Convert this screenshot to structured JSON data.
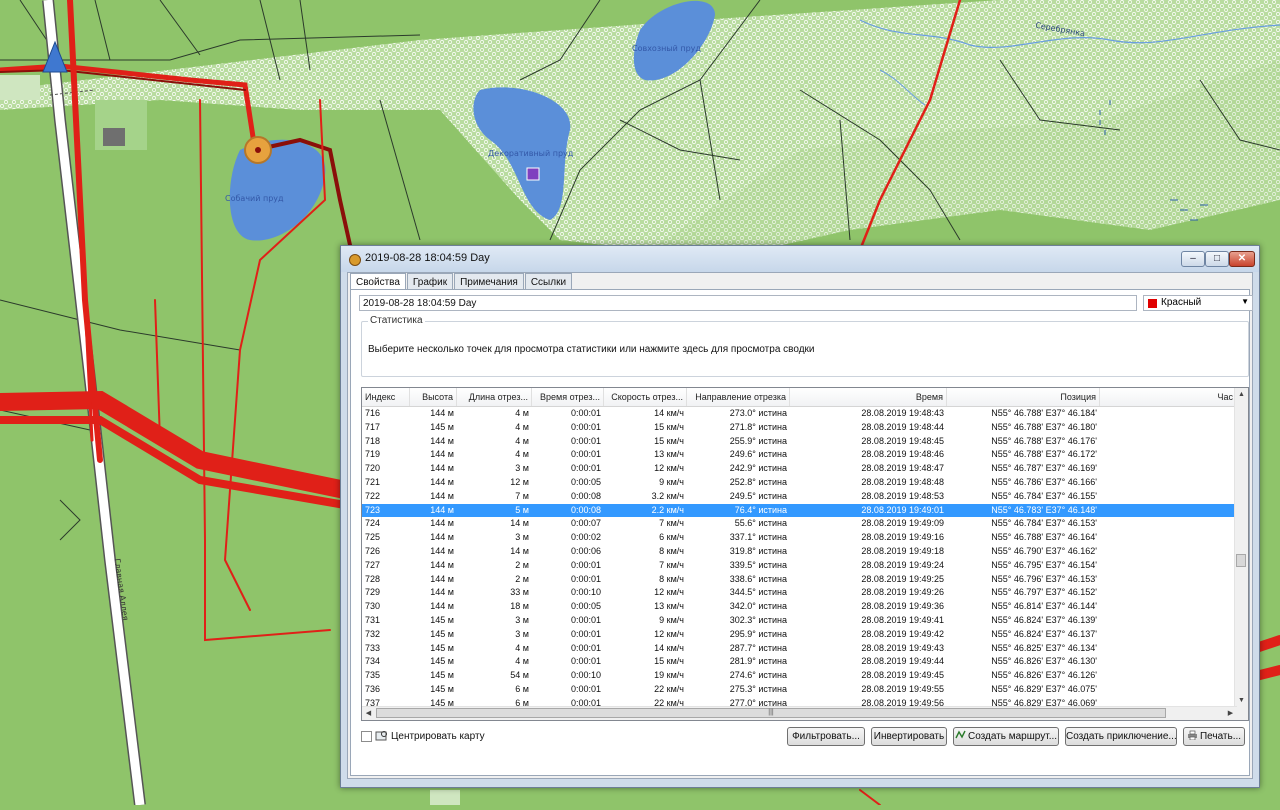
{
  "map": {
    "labels": {
      "pond1": "Собачий пруд",
      "pond2": "Декоративный пруд",
      "pond3": "Совхозный пруд",
      "river": "Серебрянка",
      "street": "Главная Аллея"
    }
  },
  "window": {
    "title": "2019-08-28 18:04:59 Day",
    "tabs": [
      "Свойства",
      "График",
      "Примечания",
      "Ссылки"
    ],
    "name_value": "2019-08-28 18:04:59 Day",
    "color_value": "Красный",
    "color_swatch": "#e00000",
    "stats_legend": "Статистика",
    "stats_text": "Выберите несколько точек для просмотра статистики или нажмите здесь для просмотра сводки",
    "columns": [
      "Индекс",
      "Высота",
      "Длина отрез...",
      "Время отрез...",
      "Скорость отрез...",
      "Направление отрезка",
      "Время",
      "Позиция",
      "Час"
    ],
    "rows": [
      [
        "716",
        "144 м",
        "4 м",
        "0:00:01",
        "14 км/ч",
        "273.0° истина",
        "28.08.2019 19:48:43",
        "N55° 46.788' E37° 46.184'"
      ],
      [
        "717",
        "145 м",
        "4 м",
        "0:00:01",
        "15 км/ч",
        "271.8° истина",
        "28.08.2019 19:48:44",
        "N55° 46.788' E37° 46.180'"
      ],
      [
        "718",
        "144 м",
        "4 м",
        "0:00:01",
        "15 км/ч",
        "255.9° истина",
        "28.08.2019 19:48:45",
        "N55° 46.788' E37° 46.176'"
      ],
      [
        "719",
        "144 м",
        "4 м",
        "0:00:01",
        "13 км/ч",
        "249.6° истина",
        "28.08.2019 19:48:46",
        "N55° 46.788' E37° 46.172'"
      ],
      [
        "720",
        "144 м",
        "3 м",
        "0:00:01",
        "12 км/ч",
        "242.9° истина",
        "28.08.2019 19:48:47",
        "N55° 46.787' E37° 46.169'"
      ],
      [
        "721",
        "144 м",
        "12 м",
        "0:00:05",
        "9 км/ч",
        "252.8° истина",
        "28.08.2019 19:48:48",
        "N55° 46.786' E37° 46.166'"
      ],
      [
        "722",
        "144 м",
        "7 м",
        "0:00:08",
        "3.2 км/ч",
        "249.5° истина",
        "28.08.2019 19:48:53",
        "N55° 46.784' E37° 46.155'"
      ],
      [
        "723",
        "144 м",
        "5 м",
        "0:00:08",
        "2.2 км/ч",
        "76.4° истина",
        "28.08.2019 19:49:01",
        "N55° 46.783' E37° 46.148'"
      ],
      [
        "724",
        "144 м",
        "14 м",
        "0:00:07",
        "7 км/ч",
        "55.6° истина",
        "28.08.2019 19:49:09",
        "N55° 46.784' E37° 46.153'"
      ],
      [
        "725",
        "144 м",
        "3 м",
        "0:00:02",
        "6 км/ч",
        "337.1° истина",
        "28.08.2019 19:49:16",
        "N55° 46.788' E37° 46.164'"
      ],
      [
        "726",
        "144 м",
        "14 м",
        "0:00:06",
        "8 км/ч",
        "319.8° истина",
        "28.08.2019 19:49:18",
        "N55° 46.790' E37° 46.162'"
      ],
      [
        "727",
        "144 м",
        "2 м",
        "0:00:01",
        "7 км/ч",
        "339.5° истина",
        "28.08.2019 19:49:24",
        "N55° 46.795' E37° 46.154'"
      ],
      [
        "728",
        "144 м",
        "2 м",
        "0:00:01",
        "8 км/ч",
        "338.6° истина",
        "28.08.2019 19:49:25",
        "N55° 46.796' E37° 46.153'"
      ],
      [
        "729",
        "144 м",
        "33 м",
        "0:00:10",
        "12 км/ч",
        "344.5° истина",
        "28.08.2019 19:49:26",
        "N55° 46.797' E37° 46.152'"
      ],
      [
        "730",
        "144 м",
        "18 м",
        "0:00:05",
        "13 км/ч",
        "342.0° истина",
        "28.08.2019 19:49:36",
        "N55° 46.814' E37° 46.144'"
      ],
      [
        "731",
        "145 м",
        "3 м",
        "0:00:01",
        "9 км/ч",
        "302.3° истина",
        "28.08.2019 19:49:41",
        "N55° 46.824' E37° 46.139'"
      ],
      [
        "732",
        "145 м",
        "3 м",
        "0:00:01",
        "12 км/ч",
        "295.9° истина",
        "28.08.2019 19:49:42",
        "N55° 46.824' E37° 46.137'"
      ],
      [
        "733",
        "145 м",
        "4 м",
        "0:00:01",
        "14 км/ч",
        "287.7° истина",
        "28.08.2019 19:49:43",
        "N55° 46.825' E37° 46.134'"
      ],
      [
        "734",
        "145 м",
        "4 м",
        "0:00:01",
        "15 км/ч",
        "281.9° истина",
        "28.08.2019 19:49:44",
        "N55° 46.826' E37° 46.130'"
      ],
      [
        "735",
        "145 м",
        "54 м",
        "0:00:10",
        "19 км/ч",
        "274.6° истина",
        "28.08.2019 19:49:45",
        "N55° 46.826' E37° 46.126'"
      ],
      [
        "736",
        "145 м",
        "6 м",
        "0:00:01",
        "22 км/ч",
        "275.3° истина",
        "28.08.2019 19:49:55",
        "N55° 46.829' E37° 46.075'"
      ],
      [
        "737",
        "145 м",
        "6 м",
        "0:00:01",
        "22 км/ч",
        "277.0° истина",
        "28.08.2019 19:49:56",
        "N55° 46.829' E37° 46.069'"
      ]
    ],
    "selected_index": "723",
    "center_map_label": "Центрировать карту",
    "buttons": {
      "filter": "Фильтровать...",
      "invert": "Инвертировать",
      "create_route": "Создать маршрут...",
      "create_adventure": "Создать приключение...",
      "print": "Печать..."
    }
  }
}
